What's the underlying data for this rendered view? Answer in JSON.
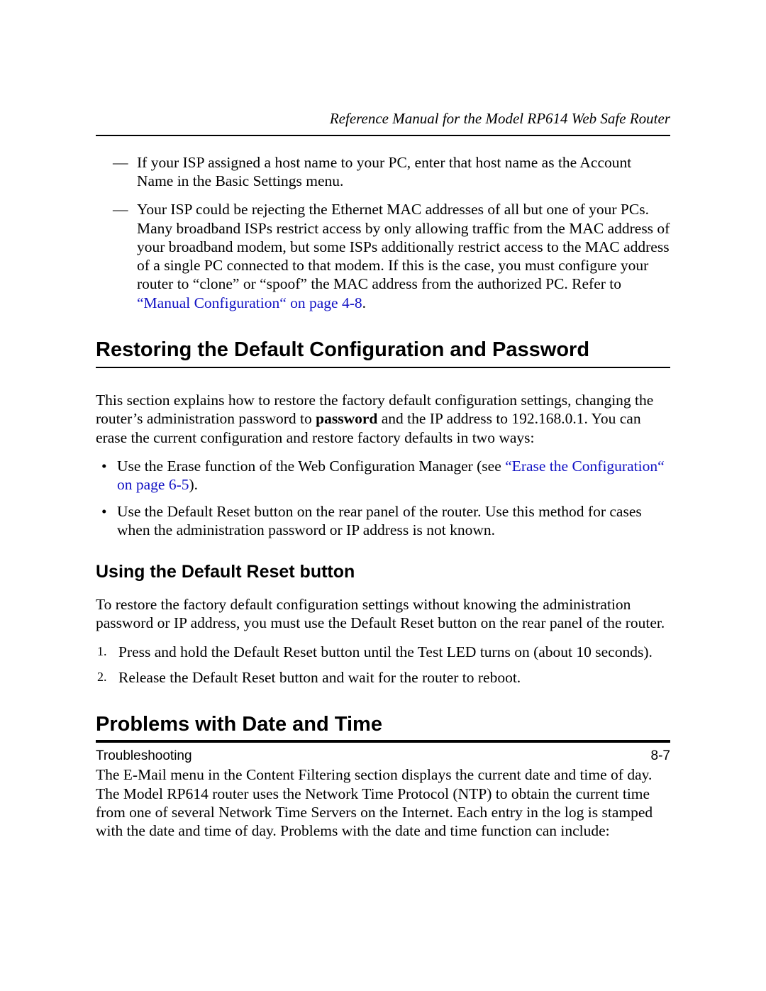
{
  "header": {
    "running_title": "Reference Manual for the Model RP614 Web Safe Router"
  },
  "dash_items": [
    {
      "text": "If your ISP assigned a host name to your PC, enter that host name as the Account Name in the Basic Settings menu."
    },
    {
      "text_before_link": "Your ISP could be rejecting the Ethernet MAC addresses of all but one of your PCs. Many broadband ISPs restrict access by only allowing traffic from the MAC address of your broadband modem, but some ISPs additionally restrict access to the MAC address of a single PC connected to that modem. If this is the case, you must configure your router to “clone” or “spoof” the MAC address from the authorized PC. Refer to ",
      "link_text": "“Manual Configuration“ on page 4-8",
      "text_after_link": "."
    }
  ],
  "section1": {
    "heading": "Restoring the Default Configuration and Password",
    "para_before_bold": "This section explains how to restore the factory default configuration settings, changing the router’s administration password to ",
    "bold_word": "password",
    "para_after_bold": " and the IP address to 192.168.0.1. You can erase the current configuration and restore factory defaults in two ways:",
    "bullets": [
      {
        "before": "Use the Erase function of the Web Configuration Manager (see ",
        "link": "“Erase the Configuration“ on page 6-5",
        "after": ")."
      },
      {
        "before": "Use the Default Reset button on the rear panel of the router. Use this method for cases when the administration password or IP address is not known.",
        "link": "",
        "after": ""
      }
    ],
    "subheading": "Using the Default Reset button",
    "sub_para": "To restore the factory default configuration settings without knowing the administration password or IP address, you must use the Default Reset button on the rear panel of the router.",
    "steps": [
      "Press and hold the Default Reset button until the Test LED turns on (about 10 seconds).",
      "Release the Default Reset button and wait for the router to reboot."
    ]
  },
  "section2": {
    "heading": "Problems with Date and Time",
    "para": "The E-Mail menu in the Content Filtering section displays the current date and time of day. The Model RP614 router uses the Network Time Protocol (NTP) to obtain the current time from one of several Network Time Servers on the Internet. Each entry in the log is stamped with the date and time of day. Problems with the date and time function can include:"
  },
  "footer": {
    "left": "Troubleshooting",
    "right": "8-7"
  }
}
